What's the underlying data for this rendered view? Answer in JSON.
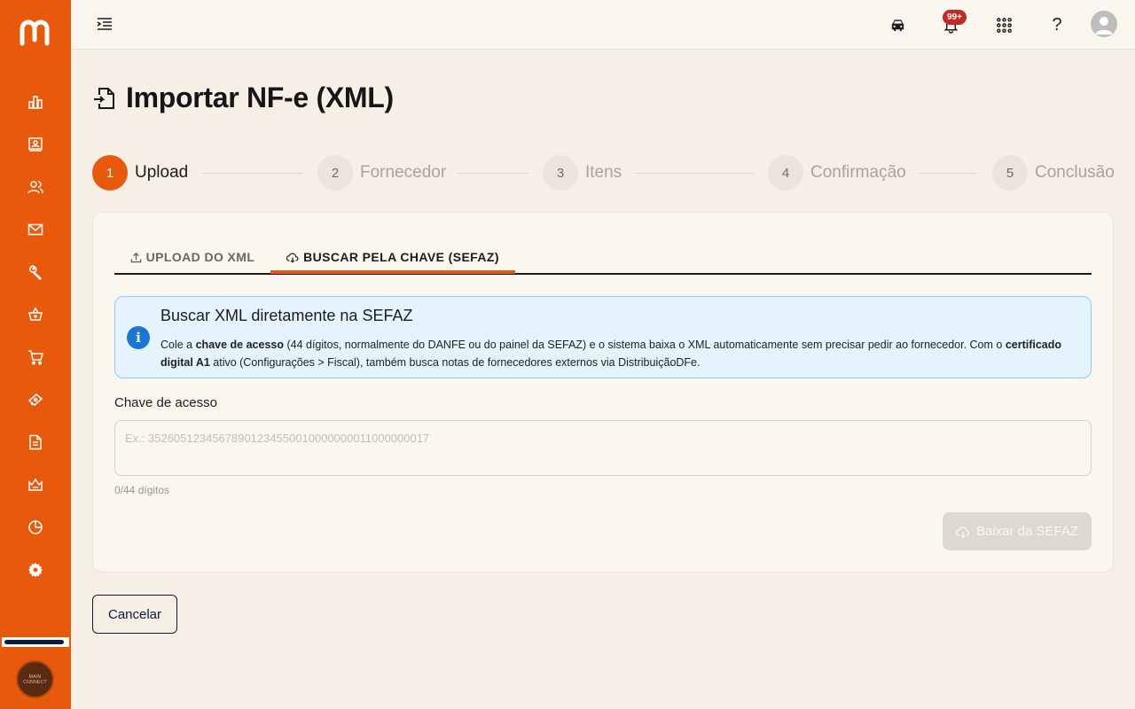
{
  "sidebar": {
    "logo": "m-logo",
    "items": [
      {
        "name": "dashboard",
        "icon": "bar-chart-icon"
      },
      {
        "name": "customers",
        "icon": "contact-card-icon"
      },
      {
        "name": "users",
        "icon": "users-icon"
      },
      {
        "name": "messages",
        "icon": "mail-icon"
      },
      {
        "name": "services",
        "icon": "wrench-icon"
      },
      {
        "name": "purchases",
        "icon": "basket-icon"
      },
      {
        "name": "sales",
        "icon": "cart-icon"
      },
      {
        "name": "finance",
        "icon": "money-icon"
      },
      {
        "name": "documents",
        "icon": "document-icon"
      },
      {
        "name": "products",
        "icon": "crown-box-icon"
      },
      {
        "name": "reports",
        "icon": "pie-chart-icon"
      },
      {
        "name": "settings",
        "icon": "gear-icon"
      }
    ],
    "progress": 0.95,
    "avatar_text": "MAIN CONNECT"
  },
  "topbar": {
    "notification_badge": "99+",
    "icons": [
      "car-icon",
      "bell-icon",
      "apps-grid-icon",
      "help-icon",
      "user-avatar-icon"
    ]
  },
  "page": {
    "title": "Importar NF-e (XML)"
  },
  "stepper": [
    {
      "number": "1",
      "label": "Upload",
      "active": true
    },
    {
      "number": "2",
      "label": "Fornecedor",
      "active": false
    },
    {
      "number": "3",
      "label": "Itens",
      "active": false
    },
    {
      "number": "4",
      "label": "Confirmação",
      "active": false
    },
    {
      "number": "5",
      "label": "Conclusão",
      "active": false
    }
  ],
  "tabs": [
    {
      "label": "UPLOAD DO XML",
      "icon": "upload-icon",
      "active": false
    },
    {
      "label": "BUSCAR PELA CHAVE (SEFAZ)",
      "icon": "cloud-download-icon",
      "active": true
    }
  ],
  "info": {
    "title": "Buscar XML diretamente na SEFAZ",
    "text_1": "Cole a ",
    "bold_1": "chave de acesso",
    "text_2": " (44 dígitos, normalmente do DANFE ou do painel da SEFAZ) e o sistema baixa o XML automaticamente sem precisar pedir ao fornecedor. Com o ",
    "bold_2": "certificado digital A1",
    "text_3": " ativo (Configurações > Fiscal), também busca notas de fornecedores externos via DistribuiçãoDFe."
  },
  "form": {
    "label": "Chave de acesso",
    "value": "",
    "placeholder": "Ex.: 35260512345678901234550010000000011000000017",
    "counter": "0/44 dígitos",
    "submit_label": "Baixar da SEFAZ"
  },
  "footer": {
    "cancel_label": "Cancelar"
  },
  "colors": {
    "brand": "#e8590c",
    "navy": "#0b1a3a",
    "info_bg": "#e4f3fc",
    "info_accent": "#1976d2",
    "badge": "#c62828"
  }
}
